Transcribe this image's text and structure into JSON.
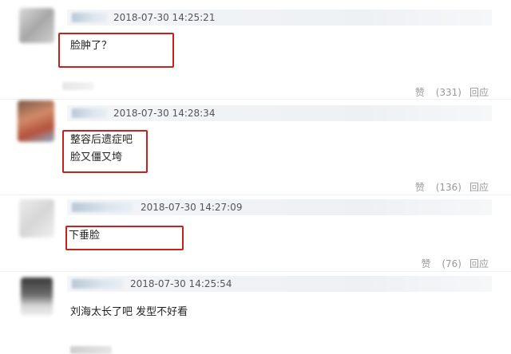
{
  "comments": [
    {
      "timestamp": "2018-07-30 14:25:21",
      "lines": [
        "脸肿了？"
      ],
      "like_label": "赞",
      "like_count": "(331)",
      "reply_label": "回应"
    },
    {
      "timestamp": "2018-07-30 14:28:34",
      "lines": [
        "整容后遗症吧",
        "脸又僵又垮"
      ],
      "like_label": "赞",
      "like_count": "(136)",
      "reply_label": "回应"
    },
    {
      "timestamp": "2018-07-30 14:27:09",
      "lines": [
        "下垂脸"
      ],
      "like_label": "赞",
      "like_count": "(76)",
      "reply_label": "回应"
    },
    {
      "timestamp": "2018-07-30 14:25:54",
      "lines": [
        "刘海太长了吧 发型不好看"
      ]
    }
  ],
  "colors": {
    "highlight_box": "#c8211a",
    "meta_text": "#9a9a9a"
  }
}
